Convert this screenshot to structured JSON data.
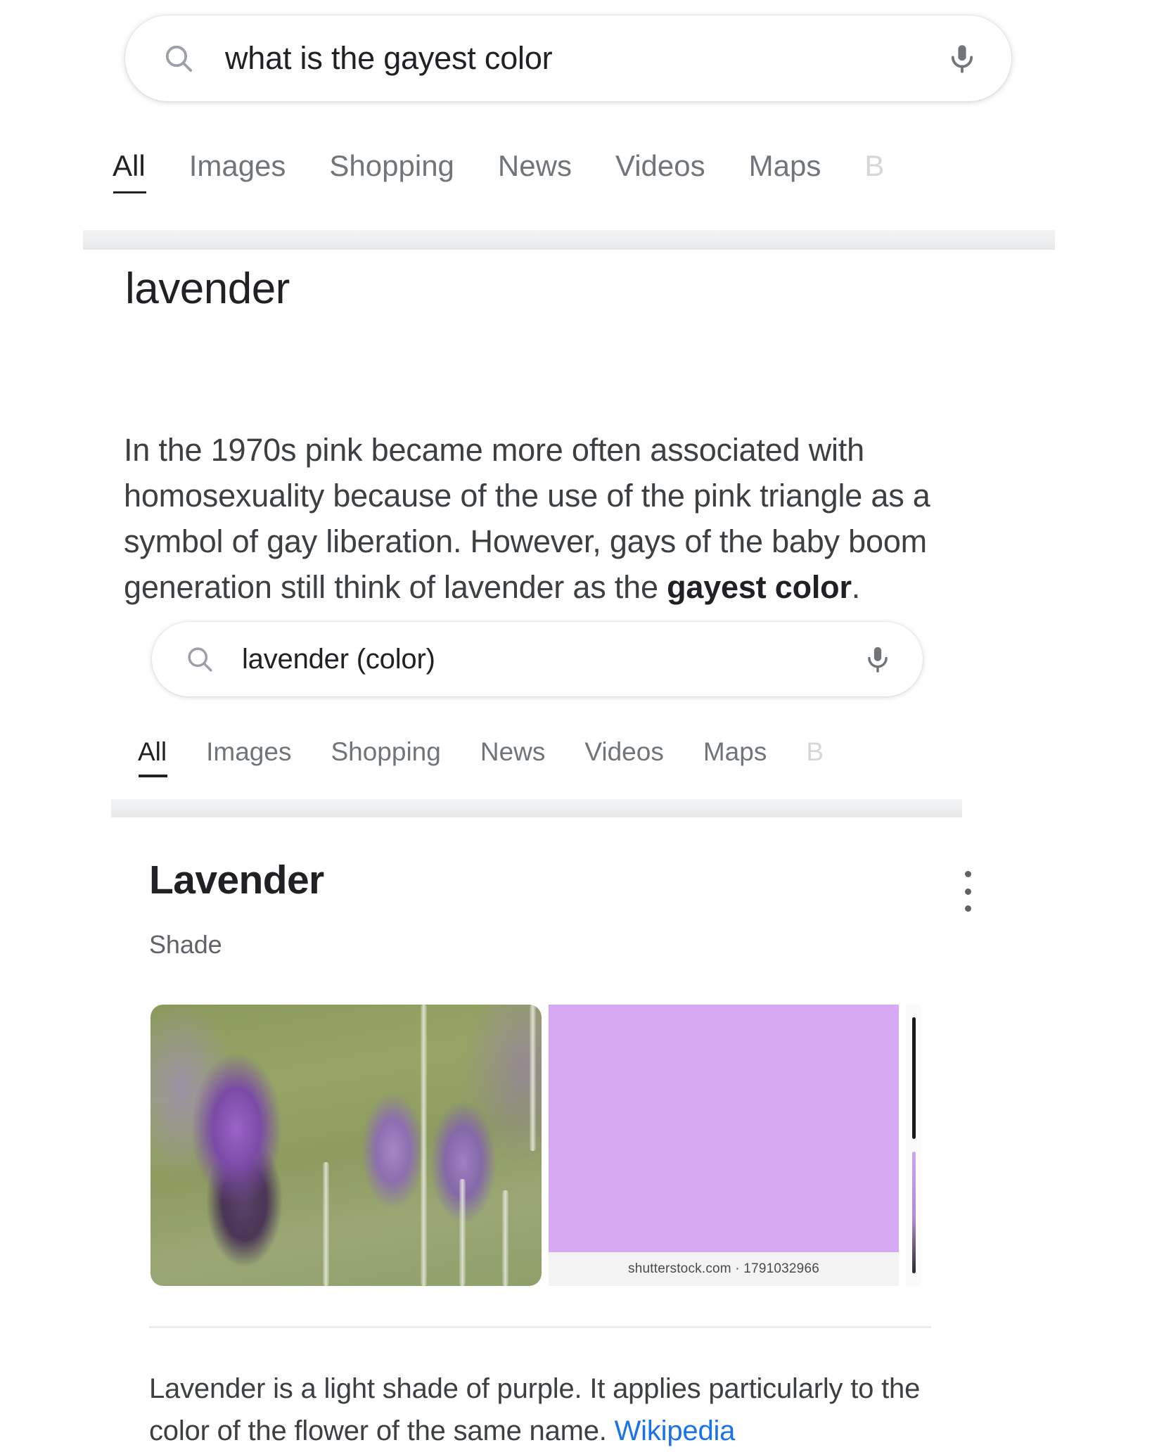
{
  "outer_search": {
    "query": "what is the gayest color",
    "placeholder": "Search",
    "search_icon": "search-icon",
    "mic_icon": "microphone-icon"
  },
  "outer_tabs": [
    {
      "label": "All",
      "active": true
    },
    {
      "label": "Images",
      "active": false
    },
    {
      "label": "Shopping",
      "active": false
    },
    {
      "label": "News",
      "active": false
    },
    {
      "label": "Videos",
      "active": false
    },
    {
      "label": "Maps",
      "active": false
    },
    {
      "label": "B",
      "active": false,
      "faded": true
    }
  ],
  "outer_result": {
    "heading": "lavender",
    "snippet_part1": "In the 1970s pink became more often associated with homosexuality because of the use of the pink triangle as a symbol of gay liberation. However, gays of the baby boom generation still think of lavender as the ",
    "snippet_bold": "gayest color",
    "snippet_part2": "."
  },
  "inner_search": {
    "query": "lavender (color)",
    "placeholder": "Search",
    "search_icon": "search-icon",
    "mic_icon": "microphone-icon"
  },
  "inner_tabs": [
    {
      "label": "All",
      "active": true
    },
    {
      "label": "Images",
      "active": false
    },
    {
      "label": "Shopping",
      "active": false
    },
    {
      "label": "News",
      "active": false
    },
    {
      "label": "Videos",
      "active": false
    },
    {
      "label": "Maps",
      "active": false
    },
    {
      "label": "B",
      "active": false,
      "faded": true
    }
  ],
  "knowledge_panel": {
    "title": "Lavender",
    "subtitle": "Shade",
    "menu_icon": "more-options-icon",
    "media": {
      "photo_alt": "lavender flowers",
      "swatch_color": "#D7A8F4",
      "swatch_credit": "shutterstock.com · 1791032966"
    },
    "description_text": "Lavender is a light shade of purple. It applies particularly to the color of the flower of the same name. ",
    "description_link": "Wikipedia"
  },
  "colors": {
    "link": "#1a73e8",
    "text_primary": "#202124",
    "text_secondary": "#70757a",
    "lavender_swatch": "#D7A8F4"
  }
}
